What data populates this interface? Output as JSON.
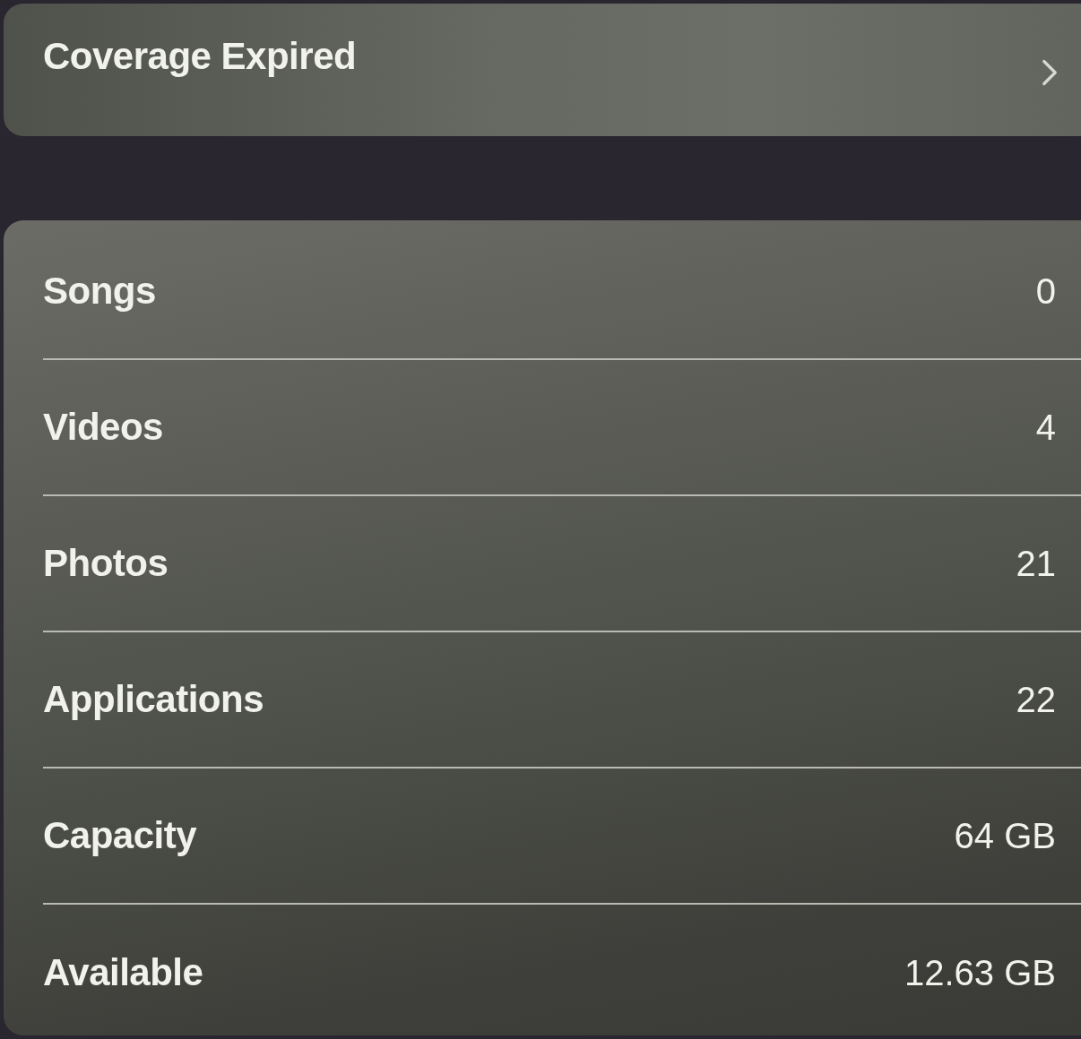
{
  "coverage_row": {
    "label": "Coverage Expired"
  },
  "info_rows": [
    {
      "label": "Songs",
      "value": "0"
    },
    {
      "label": "Videos",
      "value": "4"
    },
    {
      "label": "Photos",
      "value": "21"
    },
    {
      "label": "Applications",
      "value": "22"
    },
    {
      "label": "Capacity",
      "value": "64 GB"
    },
    {
      "label": "Available",
      "value": "12.63 GB"
    }
  ]
}
